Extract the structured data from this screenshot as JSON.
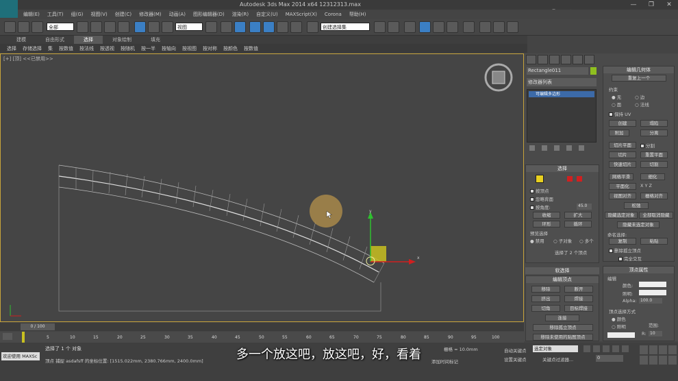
{
  "window": {
    "title": "Autodesk 3ds Max  2014 x64      12312313.max",
    "controls": [
      "—",
      "❐",
      "✕"
    ]
  },
  "watermark": "虎课网",
  "menubar": [
    "编辑(E)",
    "工具(T)",
    "组(G)",
    "视图(V)",
    "创建(C)",
    "修改器(M)",
    "动画(A)",
    "图形编辑器(D)",
    "渲染(R)",
    "自定义(U)",
    "MAXScript(X)",
    "Corona",
    "帮助(H)"
  ],
  "toolbar": {
    "filter_select": "全部",
    "ref_coord": "视图",
    "named_sel": "创建选择集"
  },
  "ribbon": {
    "tabs": [
      "建模",
      "自由形式",
      "选择",
      "对象绘制",
      "填充"
    ],
    "active_tab": "选择",
    "items": [
      "选择",
      "存储选择",
      "集",
      "按数值",
      "按法线",
      "按透视",
      "按随机",
      "按一半",
      "按轴向",
      "按视图",
      "按对称",
      "按颜色",
      "按数值"
    ]
  },
  "viewport": {
    "label": "[+] [顶] <<已禁用>>",
    "axis_x": "x",
    "axis_y": "y"
  },
  "panel": {
    "object_name": "Rectangle011",
    "object_color": "#8fbf20",
    "modifier_list": "修改器列表",
    "stack_item": "可编辑多边形",
    "selection": {
      "title": "选择",
      "by_vertex": "按顶点",
      "ignore_backfacing": "忽略背面",
      "by_angle": "按角度:",
      "angle_value": "45.0",
      "shrink": "收缩",
      "grow": "扩大",
      "ring": "环形",
      "loop": "循环",
      "preview": "预览选择",
      "disabled": "禁用",
      "subobject": "子对象",
      "multiple": "多个",
      "status": "选择了 2 个顶点"
    },
    "soft_selection": "软选择",
    "edit_vertices": {
      "title": "编辑顶点",
      "remove": "移除",
      "break": "断开",
      "extrude": "挤出",
      "weld": "焊接",
      "chamfer": "切角",
      "target_weld": "目标焊接",
      "connect": "连接",
      "remove_isolated": "移除孤立顶点",
      "remove_unused": "移除未使用的贴图顶点"
    },
    "edit_geometry": {
      "title": "编辑几何体",
      "repeat_last": "重复上一个",
      "constraints": "约束",
      "none": "无",
      "edge": "边",
      "face": "面",
      "normal": "法线",
      "preserve_uvs": "保持 UV",
      "create": "创建",
      "collapse": "塌陷",
      "attach": "附加",
      "detach": "分离",
      "slice_plane": "切片平面",
      "split": "分割",
      "slice": "切片",
      "reset_plane": "重置平面",
      "quickslice": "快速切片",
      "cut": "切割",
      "meshsmooth": "网格平滑",
      "tessellate": "细化",
      "make_planar": "平面化",
      "view_align": "视图对齐",
      "grid_align": "栅格对齐",
      "relax": "松弛",
      "hide_selected": "隐藏选定对象",
      "unhide_all": "全部取消隐藏",
      "hide_unselected": "隐藏未选定对象",
      "named_selections": "命名选择:",
      "copy": "复制",
      "paste": "粘贴",
      "delete_isolated": "删除孤立顶点",
      "full_interactivity": "完全交互"
    },
    "vertex_props": {
      "title": "顶点属性",
      "edit_label": "编辑",
      "color": "颜色:",
      "illumination": "照明:",
      "alpha_label": "Alpha:",
      "alpha": "100.0",
      "select_by": "顶点选择方式",
      "by_color": "颜色",
      "by_illum": "照明",
      "range": "范围:",
      "r_label": "R:",
      "r_value": "10"
    }
  },
  "timeline": {
    "frame": "0 / 100",
    "ticks": [
      "0",
      "5",
      "10",
      "15",
      "20",
      "25",
      "30",
      "35",
      "40",
      "45",
      "50",
      "55",
      "60",
      "65",
      "70",
      "75",
      "80",
      "85",
      "90",
      "95",
      "100"
    ]
  },
  "status": {
    "welcome": "欢迎使用 MAXSc",
    "selected": "选择了 1 个 对象",
    "prompt": "顶点 捕捉 asdafsff 的坐标位置: [1515.022mm, 2380.766mm, 2400.0mm]",
    "grid": "栅格 = 10.0mm",
    "autokey": "自动关键点",
    "set_key": "设置关键点",
    "key_mode": "选定对象",
    "key_filters": "关键点过滤器...",
    "add_time_tag": "添加时间标记",
    "frame_value": "0"
  },
  "subtitle": "多一个放这吧，放这吧，好，看着",
  "colors": {
    "accent": "#3b7fc4",
    "viewport_border": "#c8a43a",
    "gizmo_y": "#2ec02e",
    "gizmo_x": "#d02020",
    "plane": "#c8c020"
  }
}
